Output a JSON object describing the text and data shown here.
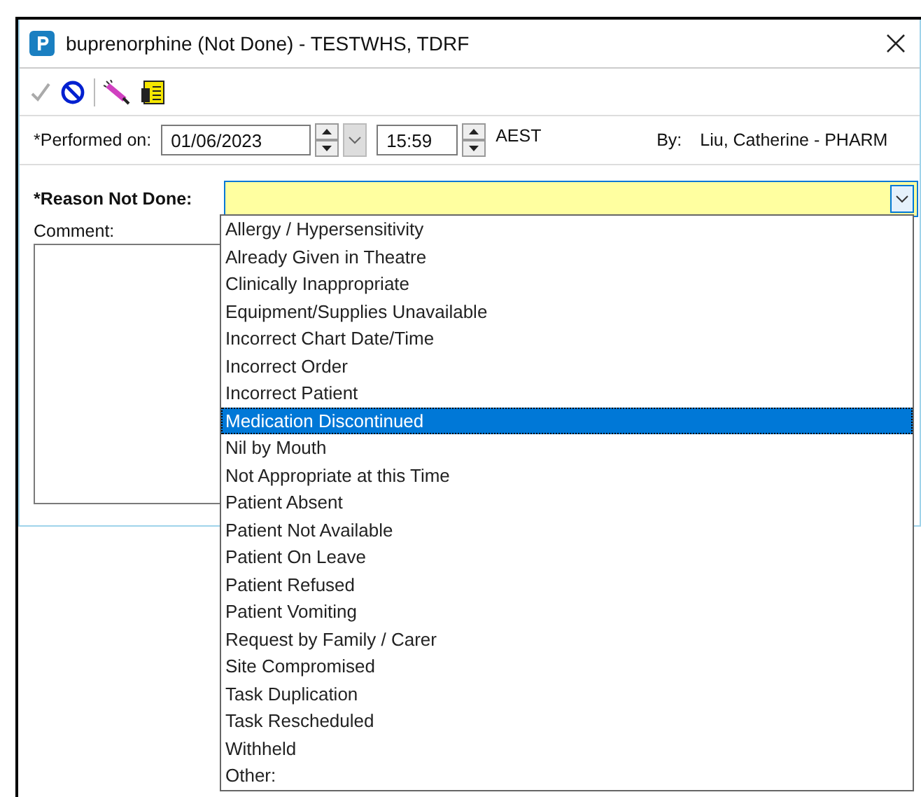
{
  "window": {
    "title": "buprenorphine (Not Done) - TESTWHS, TDRF"
  },
  "toolbar": [
    {
      "kind": "check",
      "disabled": true
    },
    {
      "kind": "prohibit",
      "disabled": false
    },
    {
      "kind": "separator"
    },
    {
      "kind": "pen",
      "disabled": false
    },
    {
      "kind": "notes",
      "disabled": false
    }
  ],
  "performed": {
    "label": "*Performed on:",
    "date": "01/06/2023",
    "time": "15:59",
    "timezone": "AEST",
    "by_label": "By:",
    "by_value": "Liu, Catherine  - PHARM"
  },
  "reason": {
    "label": "*Reason Not Done:",
    "expanded": true,
    "options": [
      {
        "label": "Allergy / Hypersensitivity",
        "selected": false
      },
      {
        "label": "Already Given in Theatre",
        "selected": false
      },
      {
        "label": "Clinically Inappropriate",
        "selected": false
      },
      {
        "label": "Equipment/Supplies Unavailable",
        "selected": false
      },
      {
        "label": "Incorrect Chart Date/Time",
        "selected": false
      },
      {
        "label": "Incorrect Order",
        "selected": false
      },
      {
        "label": "Incorrect Patient",
        "selected": false
      },
      {
        "label": "Medication Discontinued",
        "selected": true
      },
      {
        "label": "Nil by Mouth",
        "selected": false
      },
      {
        "label": "Not Appropriate at this Time",
        "selected": false
      },
      {
        "label": "Patient Absent",
        "selected": false
      },
      {
        "label": "Patient Not Available",
        "selected": false
      },
      {
        "label": "Patient On Leave",
        "selected": false
      },
      {
        "label": "Patient Refused",
        "selected": false
      },
      {
        "label": "Patient Vomiting",
        "selected": false
      },
      {
        "label": "Request by Family / Carer",
        "selected": false
      },
      {
        "label": "Site Compromised",
        "selected": false
      },
      {
        "label": "Task Duplication",
        "selected": false
      },
      {
        "label": "Task Rescheduled",
        "selected": false
      },
      {
        "label": "Withheld",
        "selected": false
      },
      {
        "label": "Other:",
        "selected": false
      }
    ]
  },
  "comment": {
    "label": "Comment:"
  }
}
